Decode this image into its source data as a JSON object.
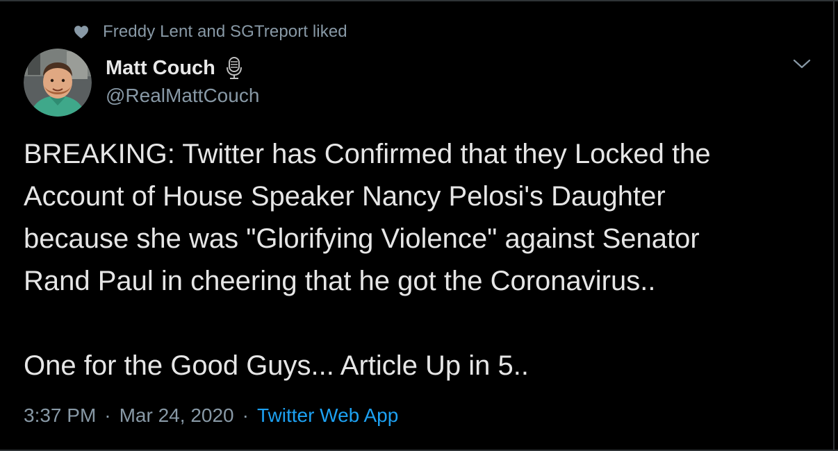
{
  "social_context": {
    "text": "Freddy Lent and SGTreport liked",
    "icon": "heart-icon"
  },
  "author": {
    "display_name": "Matt Couch",
    "handle": "@RealMattCouch",
    "badge_icon": "microphone-icon",
    "avatar_icon": "avatar"
  },
  "tweet": {
    "text": "BREAKING: Twitter has Confirmed that they Locked the\nAccount of House Speaker Nancy Pelosi's Daughter\nbecause she was \"Glorifying Violence\" against Senator\nRand Paul in cheering that he got the Coronavirus..\n\nOne for the Good Guys... Article Up in 5..",
    "time": "3:37 PM",
    "separator": "·",
    "date": "Mar 24, 2020",
    "source": "Twitter Web App"
  },
  "colors": {
    "background": "#000000",
    "text": "#e6e6e6",
    "secondary": "#8899a6",
    "link": "#1da1f2",
    "border": "#2f3336"
  }
}
